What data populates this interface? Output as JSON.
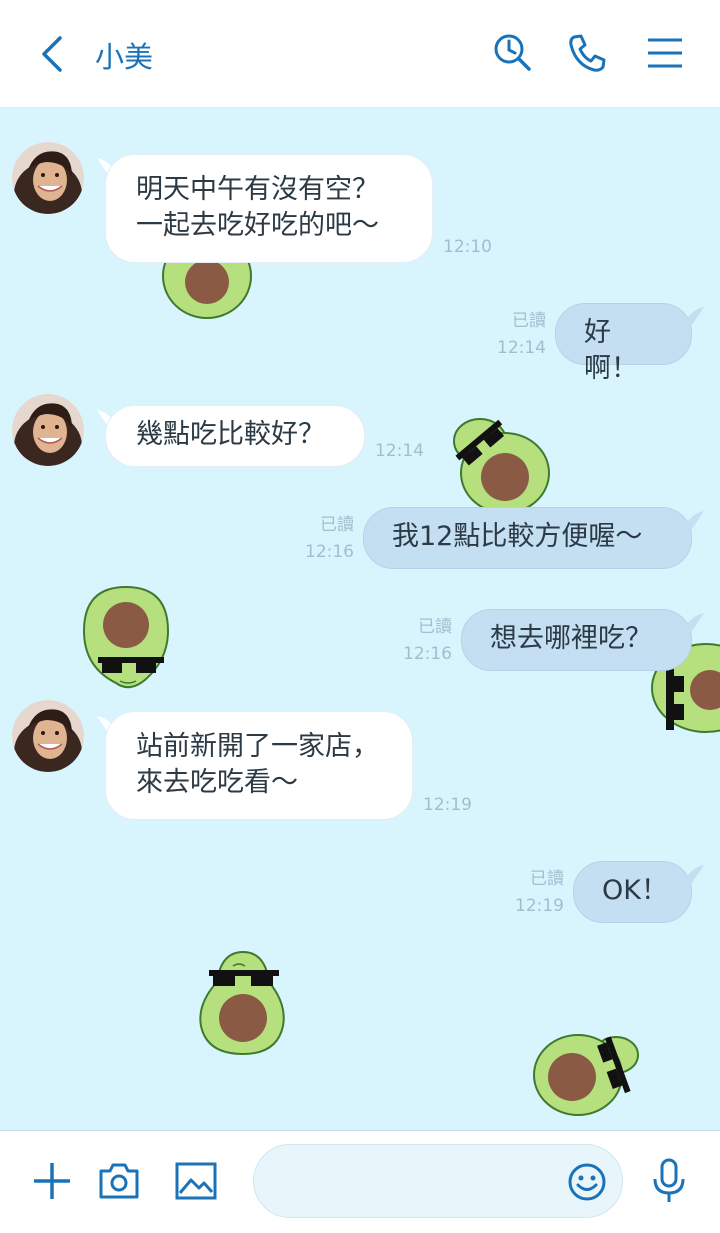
{
  "header": {
    "title": "小美"
  },
  "colors": {
    "accent": "#1a73b8",
    "chat_background": "#d8f4fd",
    "incoming_bubble": "#ffffff",
    "outgoing_bubble": "#c5dff2",
    "meta_text": "#9fbfd0"
  },
  "icons": {
    "back": "chevron-left-icon",
    "search": "clock-search-icon",
    "call": "phone-icon",
    "menu": "hamburger-menu-icon",
    "add": "plus-icon",
    "camera": "camera-icon",
    "image": "image-icon",
    "emoji": "smiley-icon",
    "voice": "microphone-icon"
  },
  "messages": [
    {
      "direction": "in",
      "text": "明天中午有沒有空？\n一起去吃好吃的吧～",
      "time": "12:10"
    },
    {
      "direction": "out",
      "text": "好啊！",
      "read": "已讀",
      "time": "12:14"
    },
    {
      "direction": "in",
      "text": "幾點吃比較好？",
      "time": "12:14"
    },
    {
      "direction": "out",
      "text": "我12點比較方便喔～",
      "read": "已讀",
      "time": "12:16"
    },
    {
      "direction": "out",
      "text": "想去哪裡吃？",
      "read": "已讀",
      "time": "12:16"
    },
    {
      "direction": "in",
      "text": "站前新開了一家店，\n來去吃吃看～",
      "time": "12:19"
    },
    {
      "direction": "out",
      "text": "OK！",
      "read": "已讀",
      "time": "12:19"
    }
  ],
  "composer": {
    "value": "",
    "placeholder": ""
  }
}
